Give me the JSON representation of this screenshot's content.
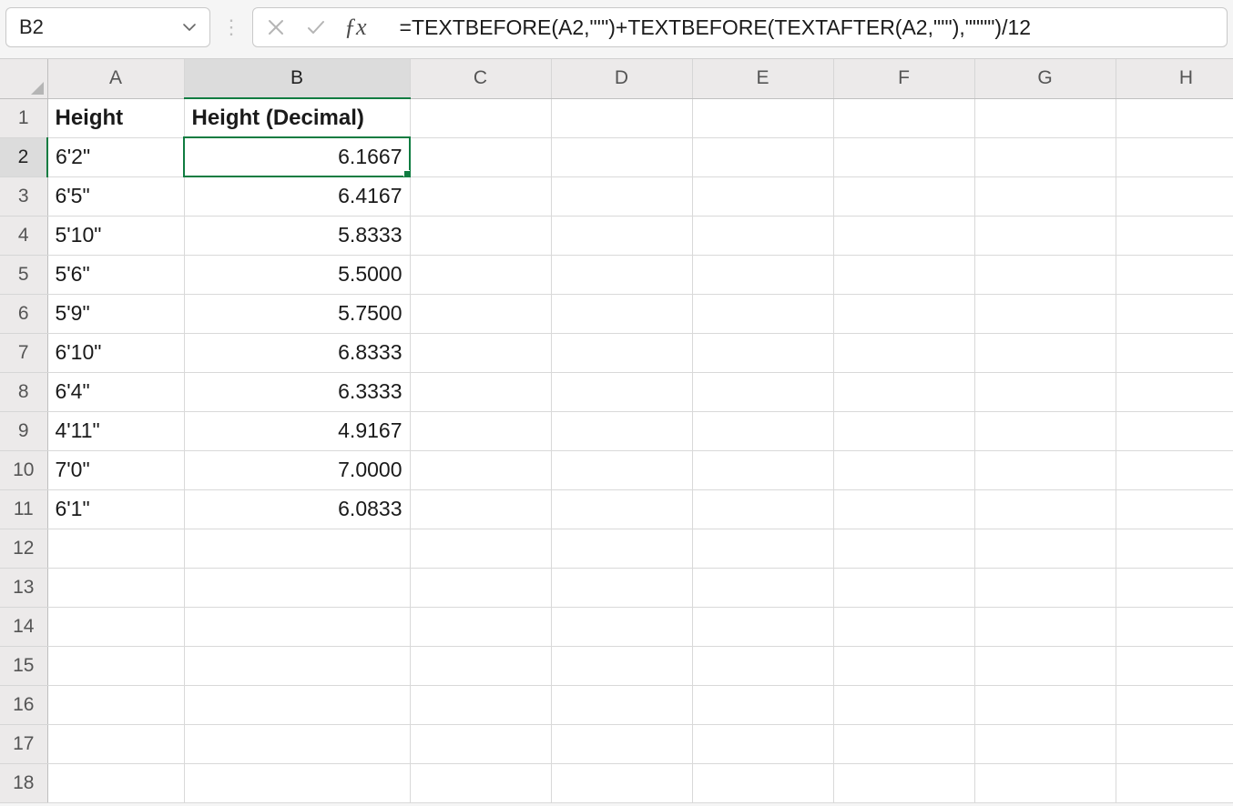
{
  "nameBox": "B2",
  "formula": "=TEXTBEFORE(A2,\"'\")+TEXTBEFORE(TEXTAFTER(A2,\"'\"),\"\"\"\")/12",
  "columns": [
    "A",
    "B",
    "C",
    "D",
    "E",
    "F",
    "G",
    "H"
  ],
  "activeCol": "B",
  "activeRow": 2,
  "rowCount": 18,
  "headers": {
    "A": "Height",
    "B": "Height (Decimal)"
  },
  "rows": [
    {
      "A": "6'2\"",
      "B": "6.1667"
    },
    {
      "A": "6'5\"",
      "B": "6.4167"
    },
    {
      "A": "5'10\"",
      "B": "5.8333"
    },
    {
      "A": "5'6\"",
      "B": "5.5000"
    },
    {
      "A": "5'9\"",
      "B": "5.7500"
    },
    {
      "A": "6'10\"",
      "B": "6.8333"
    },
    {
      "A": "6'4\"",
      "B": "6.3333"
    },
    {
      "A": "4'11\"",
      "B": "4.9167"
    },
    {
      "A": "7'0\"",
      "B": "7.0000"
    },
    {
      "A": "6'1\"",
      "B": "6.0833"
    }
  ],
  "selectedCell": "B2"
}
